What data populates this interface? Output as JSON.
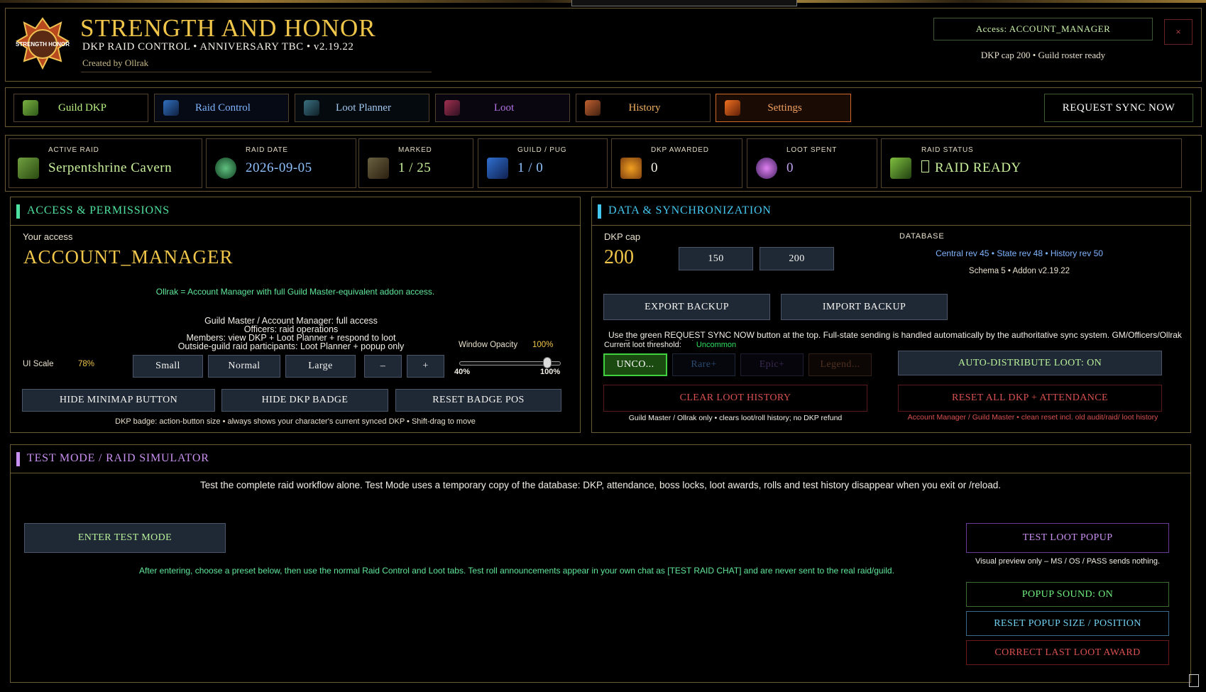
{
  "header": {
    "title": "STRENGTH AND HONOR",
    "logo_text": "STRENGTH HONOR",
    "subtitle": "DKP RAID CONTROL  •  ANNIVERSARY TBC  •  v2.19.22",
    "created_by": "Created by Ollrak",
    "access_label": "Access: ACCOUNT_MANAGER",
    "close_label": "×",
    "status": "DKP cap 200  •  Guild roster ready"
  },
  "tabs": [
    {
      "label": "Guild DKP",
      "icon": "guild-dkp-icon",
      "color": "#b8f080"
    },
    {
      "label": "Raid Control",
      "icon": "raid-control-icon",
      "color": "#7fb4ff"
    },
    {
      "label": "Loot Planner",
      "icon": "loot-planner-icon",
      "color": "#a0c8f0"
    },
    {
      "label": "Loot",
      "icon": "loot-icon",
      "color": "#b070e0"
    },
    {
      "label": "History",
      "icon": "history-icon",
      "color": "#f0b060"
    },
    {
      "label": "Settings",
      "icon": "settings-icon",
      "color": "#f0a060",
      "active": true
    }
  ],
  "sync_button": "REQUEST SYNC NOW",
  "stats": [
    {
      "label": "ACTIVE RAID",
      "value": "Serpentshrine Cavern",
      "color": "#c8f09a",
      "icon": "raid-zone-icon"
    },
    {
      "label": "RAID DATE",
      "value": "2026-09-05",
      "color": "#8ec2ff",
      "icon": "calendar-icon"
    },
    {
      "label": "MARKED",
      "value": "1 / 25",
      "color": "#c8f09a",
      "icon": "player-icon"
    },
    {
      "label": "GUILD / PUG",
      "value": "1 / 0",
      "color": "#8ec2ff",
      "icon": "guild-pug-icon"
    },
    {
      "label": "DKP AWARDED",
      "value": "0",
      "color": "#f8f4ea",
      "icon": "dkp-awarded-icon"
    },
    {
      "label": "LOOT SPENT",
      "value": "0",
      "color": "#c0a0f0",
      "icon": "loot-spent-icon"
    },
    {
      "label": "RAID STATUS",
      "value": "RAID READY",
      "color": "#c8f09a",
      "icon": "raid-status-icon"
    }
  ],
  "access": {
    "section_title": "ACCESS & PERMISSIONS",
    "your_access_label": "Your access",
    "role": "ACCOUNT_MANAGER",
    "role_note": "Ollrak = Account Manager with full Guild Master-equivalent addon access.",
    "perm_lines": [
      "Guild Master / Account Manager: full access",
      "Officers: raid operations",
      "Members: view DKP + Loot Planner + respond to loot",
      "Outside-guild raid participants: Loot Planner + popup only"
    ],
    "window_opacity_label": "Window Opacity",
    "window_opacity_value": "100%",
    "ui_scale_label": "UI Scale",
    "ui_scale_value": "78%",
    "scale_buttons": [
      "Small",
      "Normal",
      "Large",
      "–",
      "+"
    ],
    "slider_min": "40%",
    "slider_max": "100%",
    "opacity_level": 0.95,
    "buttons": [
      "HIDE MINIMAP BUTTON",
      "HIDE DKP BADGE",
      "RESET BADGE POS"
    ],
    "badge_note": "DKP badge: action-button size  •  always shows your character's current synced DKP  •  Shift-drag to move"
  },
  "data_sync": {
    "section_title": "DATA & SYNCHRONIZATION",
    "dkp_cap_label": "DKP cap",
    "dkp_cap_value": "200",
    "cap_buttons": [
      "150",
      "200"
    ],
    "database_label": "DATABASE",
    "revisions": "Central rev 45  •  State rev 48  •  History rev 50",
    "schema": "Schema 5  •  Addon v2.19.22",
    "export_label": "EXPORT BACKUP",
    "import_label": "IMPORT BACKUP",
    "sync_note": "Use the green REQUEST SYNC NOW button at the top. Full-state sending is handled automatically by the authoritative sync system. GM/Officers/Ollrak can Export/Import backups.",
    "threshold_label": "Current loot threshold:",
    "threshold_value": "Uncommon",
    "threshold_buttons": [
      "UNCO...",
      "Rare+",
      "Epic+",
      "Legend..."
    ],
    "auto_distribute": "AUTO-DISTRIBUTE LOOT: ON",
    "clear_history": "CLEAR LOOT HISTORY",
    "reset_all": "RESET ALL DKP + ATTENDANCE",
    "clear_note": "Guild Master / Ollrak only  •  clears loot/roll history; no DKP refund",
    "reset_note": "Account Manager / Guild Master  •  clean reset incl. old audit/raid/ loot history"
  },
  "test_mode": {
    "section_title": "TEST MODE / RAID SIMULATOR",
    "description": "Test the complete raid workflow alone. Test Mode uses a temporary copy of the database: DKP, attendance, boss locks, loot awards, rolls and test history disappear when you exit or /reload.",
    "enter_label": "ENTER TEST MODE",
    "after_note": "After entering, choose a preset below, then use the normal Raid Control and Loot tabs. Test roll announcements appear in your own chat as [TEST RAID CHAT] and are never sent to the real raid/guild.",
    "test_popup": "TEST LOOT POPUP",
    "popup_note": "Visual preview only – MS / OS / PASS sends nothing.",
    "popup_sound": "POPUP SOUND: ON",
    "reset_popup": "RESET POPUP SIZE / POSITION",
    "correct_award": "CORRECT LAST LOOT AWARD"
  }
}
